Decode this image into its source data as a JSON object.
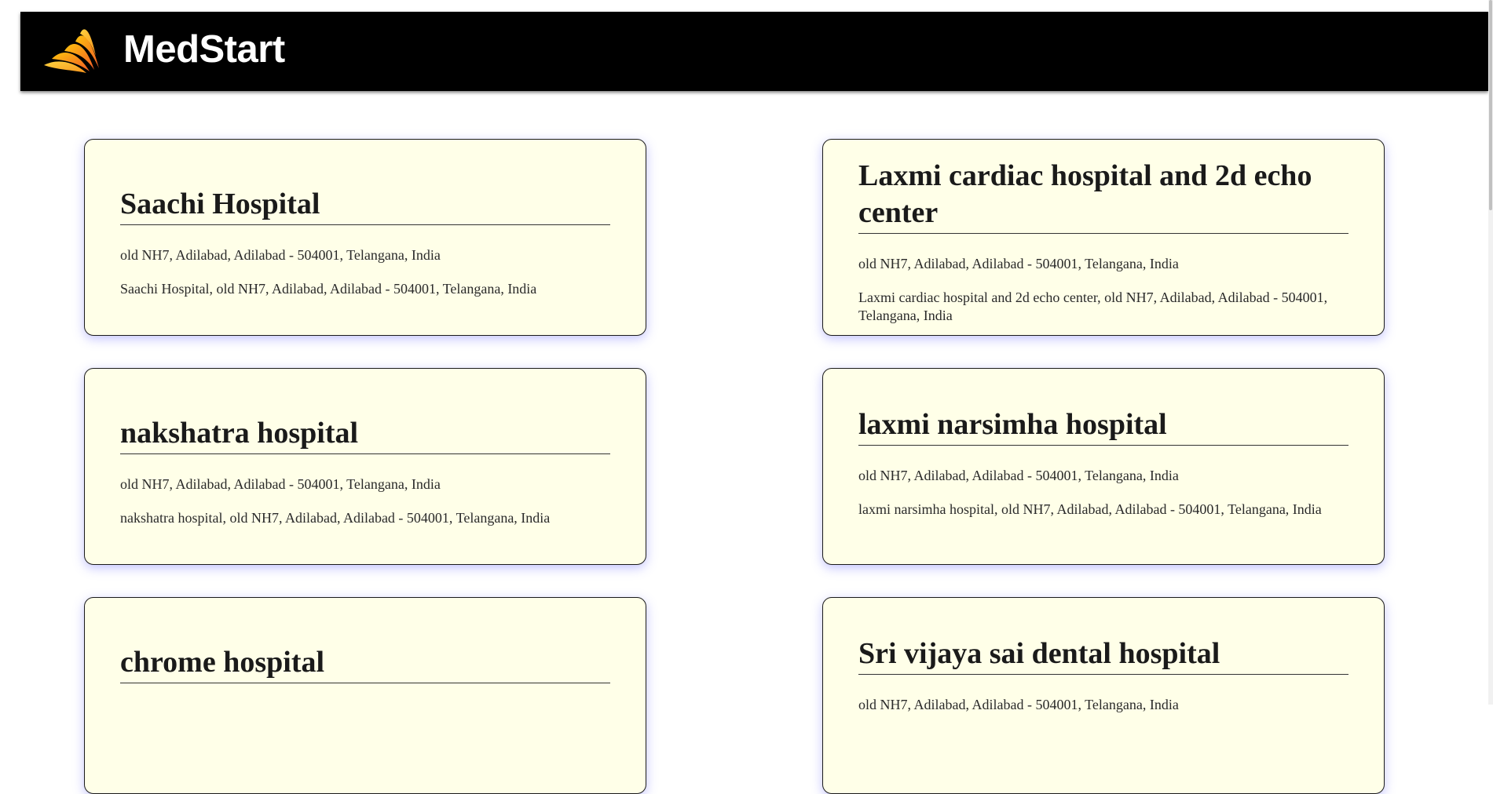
{
  "header": {
    "brand": "MedStart",
    "logo_icon": "orange-wing-flame-logo"
  },
  "hospitals": [
    {
      "name": "Saachi Hospital",
      "address": "old NH7, Adilabad, Adilabad - 504001, Telangana, India",
      "full_address": "Saachi Hospital, old NH7, Adilabad, Adilabad - 504001, Telangana, India"
    },
    {
      "name": "Laxmi cardiac hospital and 2d echo center",
      "address": "old NH7, Adilabad, Adilabad - 504001, Telangana, India",
      "full_address": "Laxmi cardiac hospital and 2d echo center, old NH7, Adilabad, Adilabad - 504001, Telangana, India"
    },
    {
      "name": "nakshatra hospital",
      "address": "old NH7, Adilabad, Adilabad - 504001, Telangana, India",
      "full_address": "nakshatra hospital, old NH7, Adilabad, Adilabad - 504001, Telangana, India"
    },
    {
      "name": "laxmi narsimha hospital",
      "address": "old NH7, Adilabad, Adilabad - 504001, Telangana, India",
      "full_address": "laxmi narsimha hospital, old NH7, Adilabad, Adilabad - 504001, Telangana, India"
    },
    {
      "name": "chrome hospital",
      "address": "",
      "full_address": ""
    },
    {
      "name": "Sri vijaya sai dental hospital",
      "address": "old NH7, Adilabad, Adilabad - 504001, Telangana, India",
      "full_address": ""
    }
  ],
  "colors": {
    "header_bg": "#000000",
    "card_bg": "#ffffe8",
    "card_shadow": "#5a5aff",
    "logo_orange": "#f7941d"
  }
}
